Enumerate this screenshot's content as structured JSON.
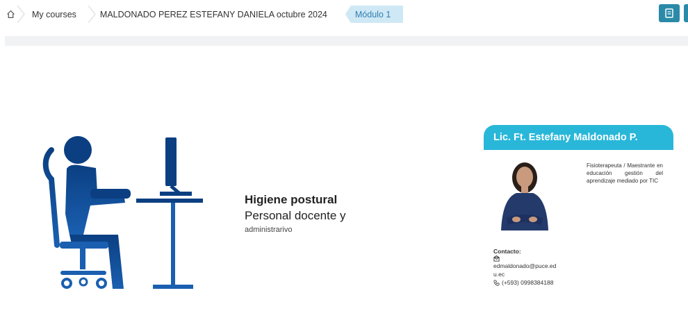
{
  "breadcrumb": {
    "items": [
      {
        "label": "My courses"
      },
      {
        "label": "MALDONADO PEREZ ESTEFANY DANIELA octubre 2024"
      },
      {
        "label": "Módulo 1"
      }
    ]
  },
  "icons": {
    "home": "home-icon",
    "top_button": "document-icon",
    "email": "mail-icon",
    "phone": "phone-icon"
  },
  "colors": {
    "accent": "#29b7d9",
    "illustration": "#0b3f82",
    "button": "#2a8aa8"
  },
  "slide": {
    "title": "Higiene postural",
    "subtitle": "Personal docente y",
    "subtitle2": "administrarivo"
  },
  "profile": {
    "name": "Lic. Ft. Estefany Maldonado P.",
    "bio": "Fisioterapeuta / Maestrante en educación gestión del aprendizaje mediado por TIC",
    "contact_label": "Contacto:",
    "email_line1": "edmaldonado@puce.ed",
    "email_line2": "u.ec",
    "phone": "(+593) 0998384188"
  }
}
